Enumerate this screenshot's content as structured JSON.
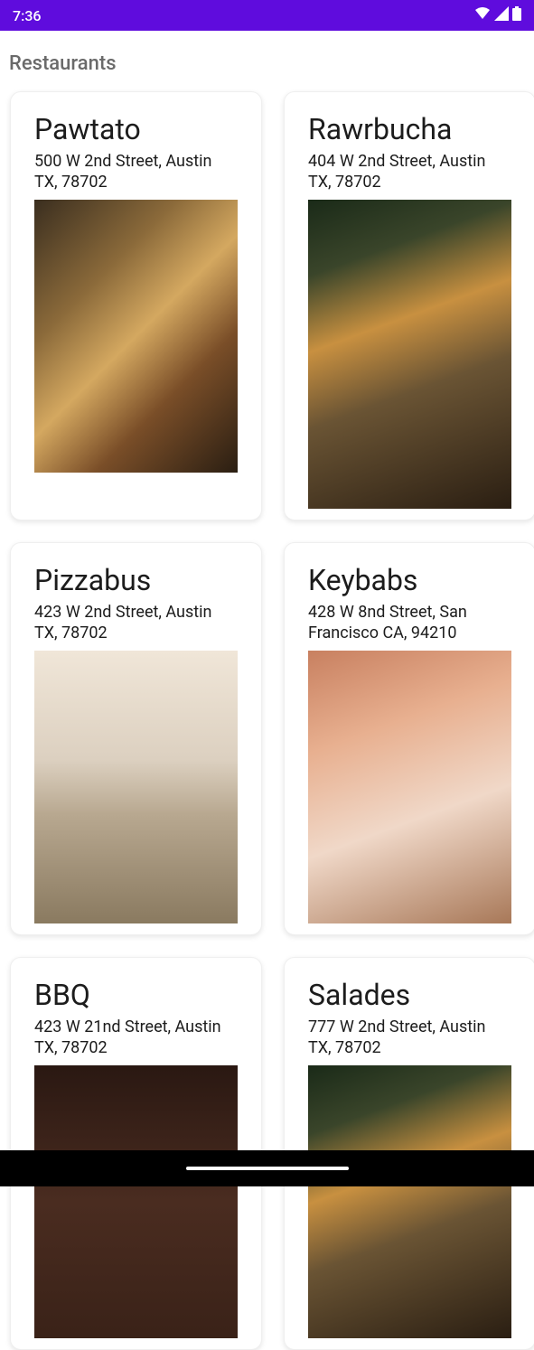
{
  "status": {
    "time": "7:36"
  },
  "page": {
    "title": "Restaurants"
  },
  "restaurants": [
    {
      "name": "Pawtato",
      "address": "500 W 2nd Street, Austin TX, 78702"
    },
    {
      "name": "Rawrbucha",
      "address": "404 W 2nd Street, Austin TX, 78702"
    },
    {
      "name": "Pizzabus",
      "address": "423 W 2nd Street, Austin TX, 78702"
    },
    {
      "name": "Keybabs",
      "address": "428 W 8nd Street, San Francisco CA, 94210"
    },
    {
      "name": "BBQ",
      "address": "423 W 21nd Street, Austin TX, 78702"
    },
    {
      "name": "Salades",
      "address": "777 W 2nd Street, Austin TX, 78702"
    }
  ]
}
